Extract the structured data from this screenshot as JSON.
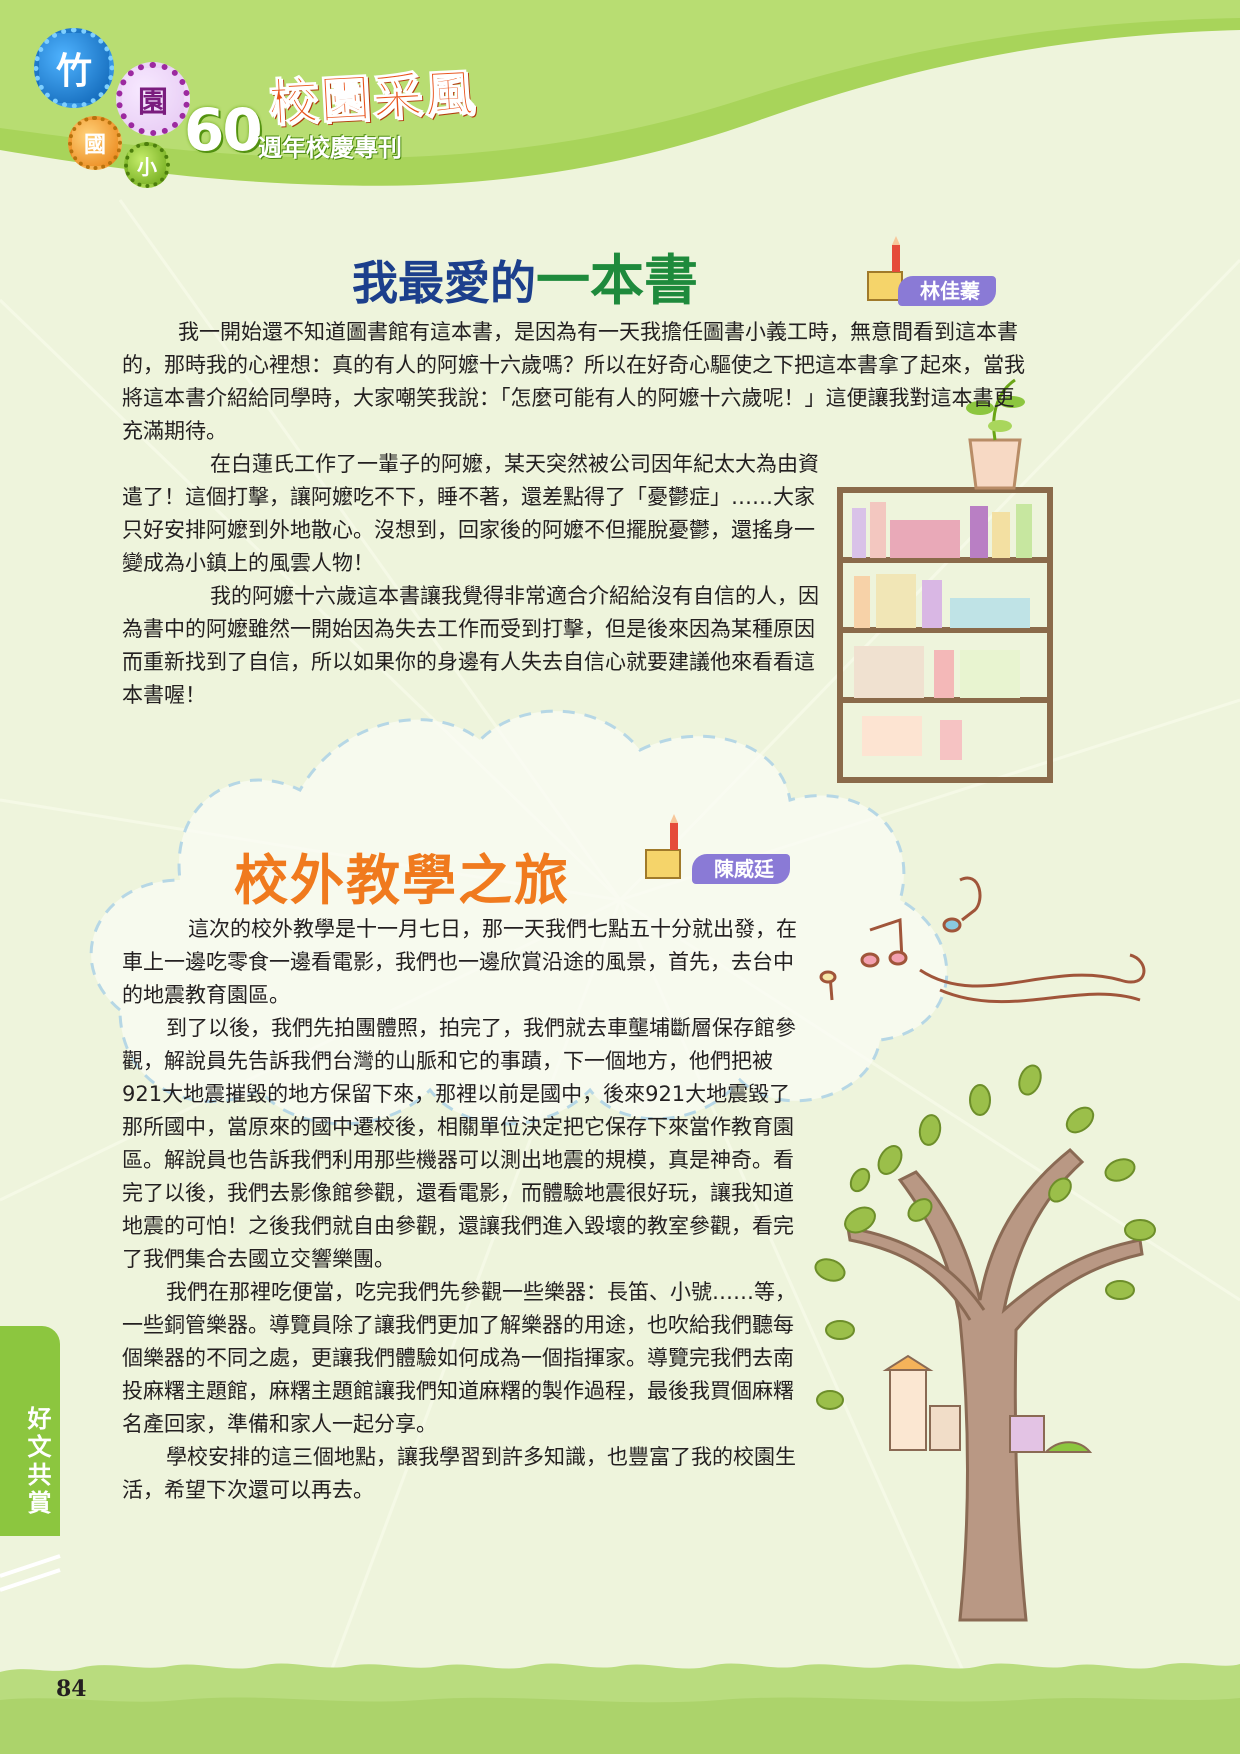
{
  "header": {
    "badges": [
      "竹",
      "園",
      "國",
      "小"
    ],
    "anniversary_number": "60",
    "anniversary_text": "週年校慶專刊",
    "magazine_title": "校園采風"
  },
  "article1": {
    "title_part1": "我最愛的",
    "title_part2": "一本書",
    "author": "林佳蓁",
    "paragraphs": [
      "我一開始還不知道圖書館有這本書，是因為有一天我擔任圖書小義工時，無意間看到這本書的，那時我的心裡想：真的有人的阿嬤十六歲嗎？所以在好奇心驅使之下把這本書拿了起來，當我將這本書介紹給同學時，大家嘲笑我說：「怎麼可能有人的阿嬤十六歲呢！」這便讓我對這本書更充滿期待。",
      "在白蓮氏工作了一輩子的阿嬤，某天突然被公司因年紀太大為由資遣了！這個打擊，讓阿嬤吃不下，睡不著，還差點得了「憂鬱症」……大家只好安排阿嬤到外地散心。沒想到，回家後的阿嬤不但擺脫憂鬱，還搖身一變成為小鎮上的風雲人物！",
      "我的阿嬤十六歲這本書讓我覺得非常適合介紹給沒有自信的人，因為書中的阿嬤雖然一開始因為失去工作而受到打擊，但是後來因為某種原因而重新找到了自信，所以如果你的身邊有人失去自信心就要建議他來看看這本書喔！"
    ]
  },
  "article2": {
    "title": "校外教學之旅",
    "author": "陳威廷",
    "paragraphs": [
      "這次的校外教學是十一月七日，那一天我們七點五十分就出發，在車上一邊吃零食一邊看電影，我們也一邊欣賞沿途的風景，首先，去台中的地震教育園區。",
      "到了以後，我們先拍團體照，拍完了，我們就去車壟埔斷層保存館參觀，解說員先告訴我們台灣的山脈和它的事蹟，下一個地方，他們把被921大地震摧毀的地方保留下來，那裡以前是國中，後來921大地震毀了那所國中，當原來的國中遷校後，相關單位決定把它保存下來當作教育園區。解說員也告訴我們利用那些機器可以測出地震的規模，真是神奇。看完了以後，我們去影像館參觀，還看電影，而體驗地震很好玩，讓我知道地震的可怕！之後我們就自由參觀，還讓我們進入毀壞的教室參觀，看完了我們集合去國立交響樂團。",
      "我們在那裡吃便當，吃完我們先參觀一些樂器：長笛、小號……等，一些銅管樂器。導覽員除了讓我們更加了解樂器的用途，也吹給我們聽每個樂器的不同之處，更讓我們體驗如何成為一個指揮家。導覽完我們去南投麻糬主題館，麻糬主題館讓我們知道麻糬的製作過程，最後我買個麻糬名產回家，準備和家人一起分享。",
      "學校安排的這三個地點，讓我學習到許多知識，也豐富了我的校園生活，希望下次還可以再去。"
    ]
  },
  "side_tab": "好文共賞",
  "page_number": "84",
  "colors": {
    "header_green": "#9acd4a",
    "footer_green": "#b9dc7e",
    "title1_blue": "#1c3f8c",
    "title1_green": "#1e8a3c",
    "title2_orange": "#f07a1e",
    "author_purple": "#8a7ad6",
    "cloud_dash": "#9fcbea"
  }
}
